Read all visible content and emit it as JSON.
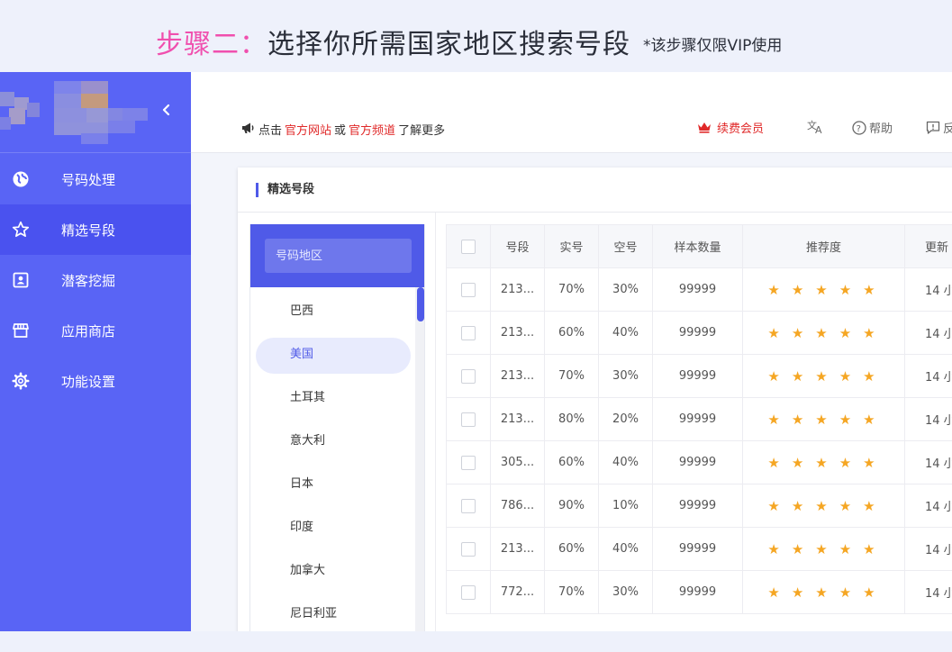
{
  "banner": {
    "step": "步骤二：",
    "title": "选择你所需国家地区搜索号段",
    "note": "*该步骤仅限VIP使用"
  },
  "sidebar": {
    "collapse_icon": "chevron-left-icon",
    "items": [
      {
        "label": "号码处理",
        "icon": "globe-icon"
      },
      {
        "label": "精选号段",
        "icon": "star-icon",
        "active": true
      },
      {
        "label": "潜客挖掘",
        "icon": "contact-card-icon"
      },
      {
        "label": "应用商店",
        "icon": "store-icon"
      },
      {
        "label": "功能设置",
        "icon": "gear-icon"
      }
    ]
  },
  "header": {
    "notice_prefix": "点击",
    "link1": "官方网站",
    "notice_or": "或",
    "link2": "官方频道",
    "notice_suffix": "了解更多",
    "vip": "续费会员",
    "help": "帮助",
    "feedback": "反"
  },
  "card": {
    "title": "精选号段"
  },
  "regions": {
    "placeholder": "号码地区",
    "items": [
      "巴西",
      "美国",
      "土耳其",
      "意大利",
      "日本",
      "印度",
      "加拿大",
      "尼日利亚"
    ],
    "active_index": 1
  },
  "table": {
    "columns": [
      "号段",
      "实号",
      "空号",
      "样本数量",
      "推荐度",
      "更新"
    ],
    "rows": [
      {
        "segment": "213...",
        "real": "70%",
        "empty": "30%",
        "samples": "99999",
        "stars": 5,
        "updated": "14 小"
      },
      {
        "segment": "213...",
        "real": "60%",
        "empty": "40%",
        "samples": "99999",
        "stars": 5,
        "updated": "14 小"
      },
      {
        "segment": "213...",
        "real": "70%",
        "empty": "30%",
        "samples": "99999",
        "stars": 5,
        "updated": "14 小"
      },
      {
        "segment": "213...",
        "real": "80%",
        "empty": "20%",
        "samples": "99999",
        "stars": 5,
        "updated": "14 小"
      },
      {
        "segment": "305...",
        "real": "60%",
        "empty": "40%",
        "samples": "99999",
        "stars": 5,
        "updated": "14 小"
      },
      {
        "segment": "786...",
        "real": "90%",
        "empty": "10%",
        "samples": "99999",
        "stars": 5,
        "updated": "14 小"
      },
      {
        "segment": "213...",
        "real": "60%",
        "empty": "40%",
        "samples": "99999",
        "stars": 5,
        "updated": "14 小"
      },
      {
        "segment": "772...",
        "real": "70%",
        "empty": "30%",
        "samples": "99999",
        "stars": 5,
        "updated": "14 小"
      }
    ]
  },
  "colors": {
    "sidebar": "#5964f5",
    "sidebar_active": "#4a52ef",
    "accent": "#4f5ae8",
    "banner_step": "#f04fae",
    "link_red": "#e02929",
    "star": "#f5a623"
  }
}
